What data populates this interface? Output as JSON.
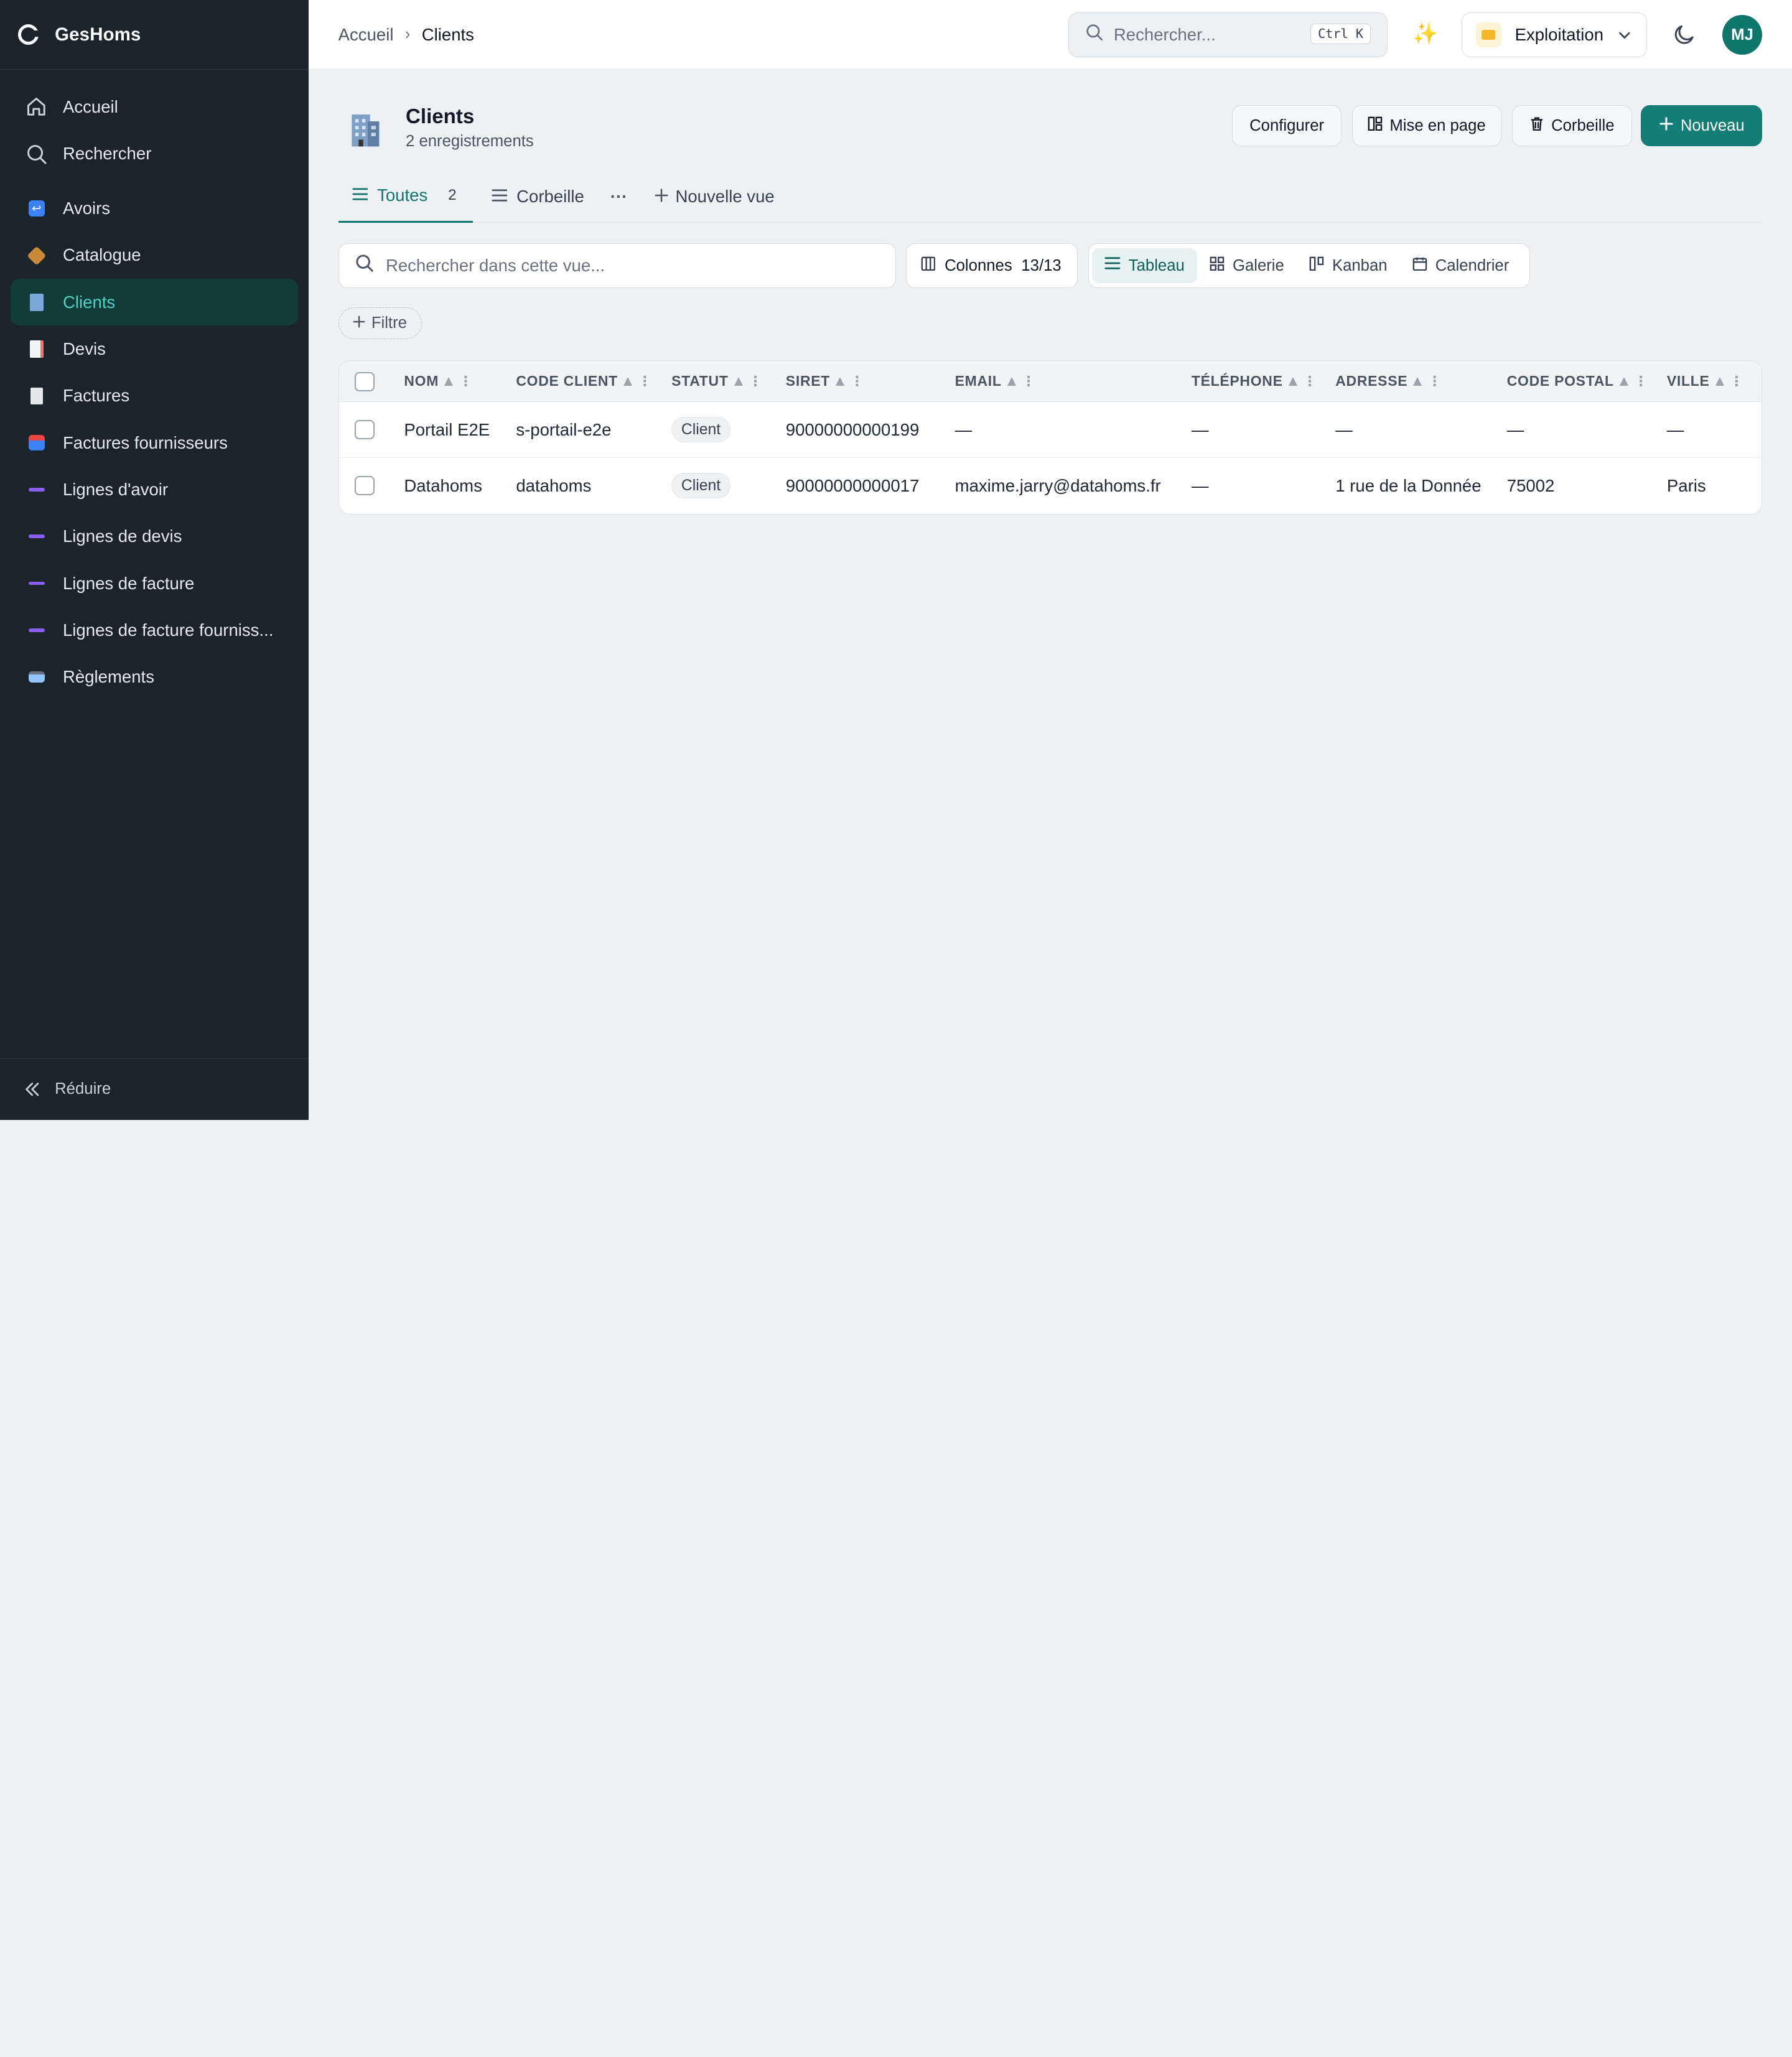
{
  "app": {
    "name": "GesHoms"
  },
  "sidebar": {
    "items": [
      {
        "label": "Accueil",
        "icon": "home-icon"
      },
      {
        "label": "Rechercher",
        "icon": "search-icon"
      },
      {
        "label": "Avoirs",
        "icon": "avoirs-icon",
        "color": "#3b82f6"
      },
      {
        "label": "Catalogue",
        "icon": "package-icon",
        "color": "#d97706"
      },
      {
        "label": "Clients",
        "icon": "building-icon",
        "color": "#60a5fa",
        "active": true
      },
      {
        "label": "Devis",
        "icon": "document-icon",
        "color": "#f87171"
      },
      {
        "label": "Factures",
        "icon": "invoice-icon",
        "color": "#e5e7eb"
      },
      {
        "label": "Factures fournisseurs",
        "icon": "inbox-icon",
        "color": "#ef4444"
      },
      {
        "label": "Lignes d'avoir",
        "icon": "line-icon",
        "color": "#8b5cf6"
      },
      {
        "label": "Lignes de devis",
        "icon": "line-icon",
        "color": "#8b5cf6"
      },
      {
        "label": "Lignes de facture",
        "icon": "line-icon",
        "color": "#8b5cf6"
      },
      {
        "label": "Lignes de facture fourniss...",
        "icon": "line-icon",
        "color": "#8b5cf6"
      },
      {
        "label": "Règlements",
        "icon": "card-icon",
        "color": "#93c5fd"
      }
    ],
    "collapse_label": "Réduire"
  },
  "topbar": {
    "breadcrumb": {
      "home": "Accueil",
      "separator": "›",
      "current": "Clients"
    },
    "search_placeholder": "Rechercher...",
    "shortcut": "Ctrl K",
    "workspace": "Exploitation",
    "avatar_initials": "MJ"
  },
  "page": {
    "title": "Clients",
    "subtitle": "2 enregistrements",
    "buttons": {
      "configure": "Configurer",
      "layout": "Mise en page",
      "trash": "Corbeille",
      "new": "Nouveau"
    }
  },
  "tabs": {
    "all": {
      "label": "Toutes",
      "count": "2"
    },
    "trash": {
      "label": "Corbeille"
    },
    "more": "···",
    "new_view": "Nouvelle vue"
  },
  "toolbar": {
    "search_placeholder": "Rechercher dans cette vue...",
    "columns_label": "Colonnes",
    "columns_count": "13/13",
    "views": [
      "Tableau",
      "Galerie",
      "Kanban",
      "Calendrier"
    ],
    "active_view": "Tableau",
    "filter_label": "Filtre"
  },
  "table": {
    "columns": [
      "NOM",
      "CODE CLIENT",
      "STATUT",
      "SIRET",
      "EMAIL",
      "TÉLÉPHONE",
      "ADRESSE",
      "CODE POSTAL",
      "VILLE"
    ],
    "rows": [
      [
        "Portail E2E",
        "s-portail-e2e",
        "Client",
        "90000000000199",
        "—",
        "—",
        "—",
        "—",
        "—"
      ],
      [
        "Datahoms",
        "datahoms",
        "Client",
        "90000000000017",
        "maxime.jarry@datahoms.fr",
        "—",
        "1 rue de la Donnée",
        "75002",
        "Paris"
      ]
    ]
  },
  "colors": {
    "accent": "#147d75",
    "sidebar_bg": "#1b232b",
    "active_bg": "#123c3a",
    "active_text": "#4fd1c5"
  }
}
